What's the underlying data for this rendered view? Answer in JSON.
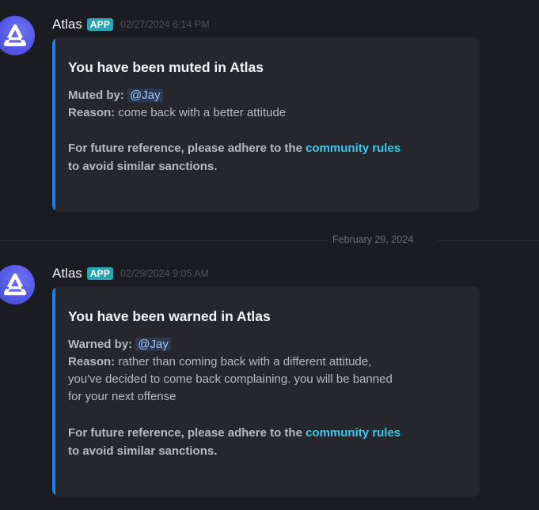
{
  "messages": [
    {
      "author": "Atlas",
      "badge": "APP",
      "timestamp": "02/27/2024 6:14 PM",
      "avatar_icon": "atlas-logo-icon",
      "embed": {
        "title": "You have been muted in Atlas",
        "actor_label": "Muted by:",
        "actor_mention": "@Jay",
        "reason_label": "Reason:",
        "reason_lines": [
          "come back with a better attitude"
        ],
        "footer_prefix": "For future reference, please adhere to the ",
        "footer_link": "community rules",
        "footer_suffix": "to avoid similar sanctions.",
        "accent_color": "#1d7ff0"
      }
    },
    {
      "author": "Atlas",
      "badge": "APP",
      "timestamp": "02/29/2024 9:05 AM",
      "avatar_icon": "atlas-logo-icon",
      "embed": {
        "title": "You have been warned in Atlas",
        "actor_label": "Warned by:",
        "actor_mention": "@Jay",
        "reason_label": "Reason:",
        "reason_lines": [
          "rather than coming back with a different attitude,",
          "you've decided to come back complaining. you will be banned",
          "for your next offense"
        ],
        "footer_prefix": "For future reference, please adhere to the ",
        "footer_link": "community rules",
        "footer_suffix": "to avoid similar sanctions.",
        "accent_color": "#1d7ff0"
      }
    }
  ],
  "date_divider": "February 29, 2024",
  "colors": {
    "background": "#1b1c21",
    "embed_background": "#26272d",
    "app_badge": "#2aa3b4",
    "link": "#3cc9ee",
    "avatar": "#5457e6"
  }
}
